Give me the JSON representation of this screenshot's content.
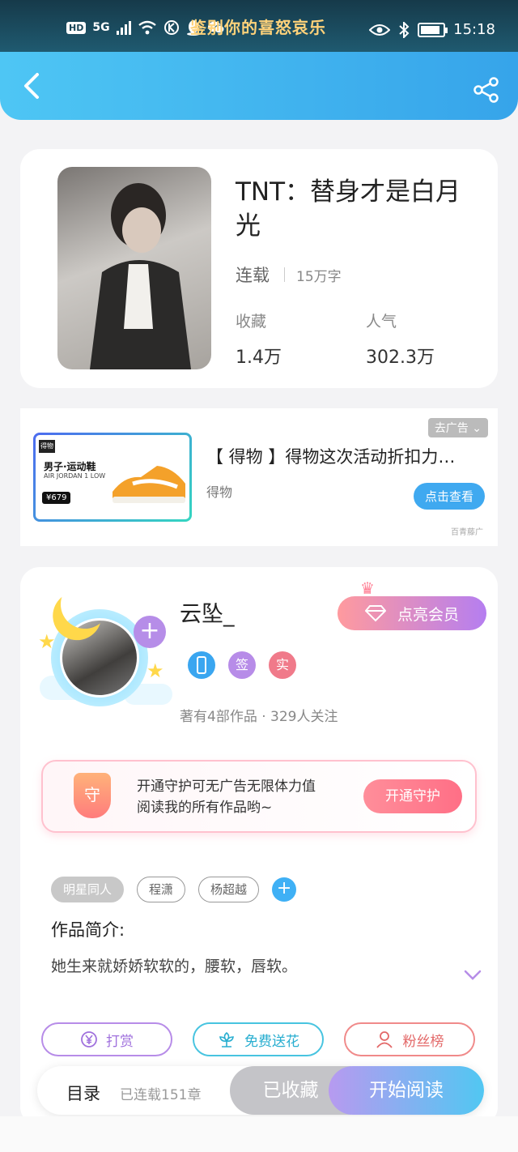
{
  "status_bar": {
    "network_badge": "HD",
    "network_type": "5G",
    "notification_title": "鉴别你的喜怒哀乐",
    "time": "15:18",
    "battery_level": 0.9,
    "icons": [
      "wifi-icon",
      "k-icon",
      "qq-icon",
      "wechat-icon",
      "eye-icon",
      "bluetooth-icon",
      "battery-icon"
    ]
  },
  "nav": {
    "back_icon": "back-arrow-icon",
    "share_icon": "share-icon"
  },
  "book": {
    "title": "TNT：替身才是白月光",
    "status": "连载",
    "word_count": "15万字",
    "favorites_label": "收藏",
    "favorites_value": "1.4万",
    "popularity_label": "人气",
    "popularity_value": "302.3万"
  },
  "ad": {
    "tag": "去广告",
    "title": "【 得物 】得物这次活动折扣力…",
    "source": "得物",
    "button": "点击查看",
    "brand": "百青藤广",
    "image": {
      "logo": "得物",
      "headline": "男子·运动鞋",
      "subline": "AIR JORDAN 1 LOW",
      "price": "¥679"
    }
  },
  "author": {
    "name": "云坠_",
    "vip_button": "点亮会员",
    "badges": [
      {
        "label": "",
        "color": "#3aa6f0"
      },
      {
        "label": "签",
        "color": "#b78ce8"
      },
      {
        "label": "实",
        "color": "#f07a8a"
      }
    ],
    "stats": "著有4部作品 · 329人关注",
    "plus": "+"
  },
  "guard": {
    "shield_label": "守",
    "text_line1": "开通守护可无广告无限体力值",
    "text_line2": "阅读我的所有作品哟~",
    "button": "开通守护"
  },
  "tags": [
    "明星同人",
    "程潇",
    "杨超越"
  ],
  "tag_add": "+",
  "intro": {
    "title": "作品简介:",
    "text": "她生来就娇娇软软的，腰软，唇软。"
  },
  "actions": {
    "reward": "打赏",
    "flower": "免费送花",
    "fans": "粉丝榜"
  },
  "bottom_bar": {
    "toc": "目录",
    "chapters": "已连载151章",
    "collected": "已收藏",
    "start_reading": "开始阅读"
  },
  "colors": {
    "nav_gradient_start": "#4ec6f4",
    "nav_gradient_end": "#36a4ea",
    "accent_purple": "#b68de8",
    "accent_pink": "#ff6f86",
    "accent_blue": "#3fa9f0"
  }
}
